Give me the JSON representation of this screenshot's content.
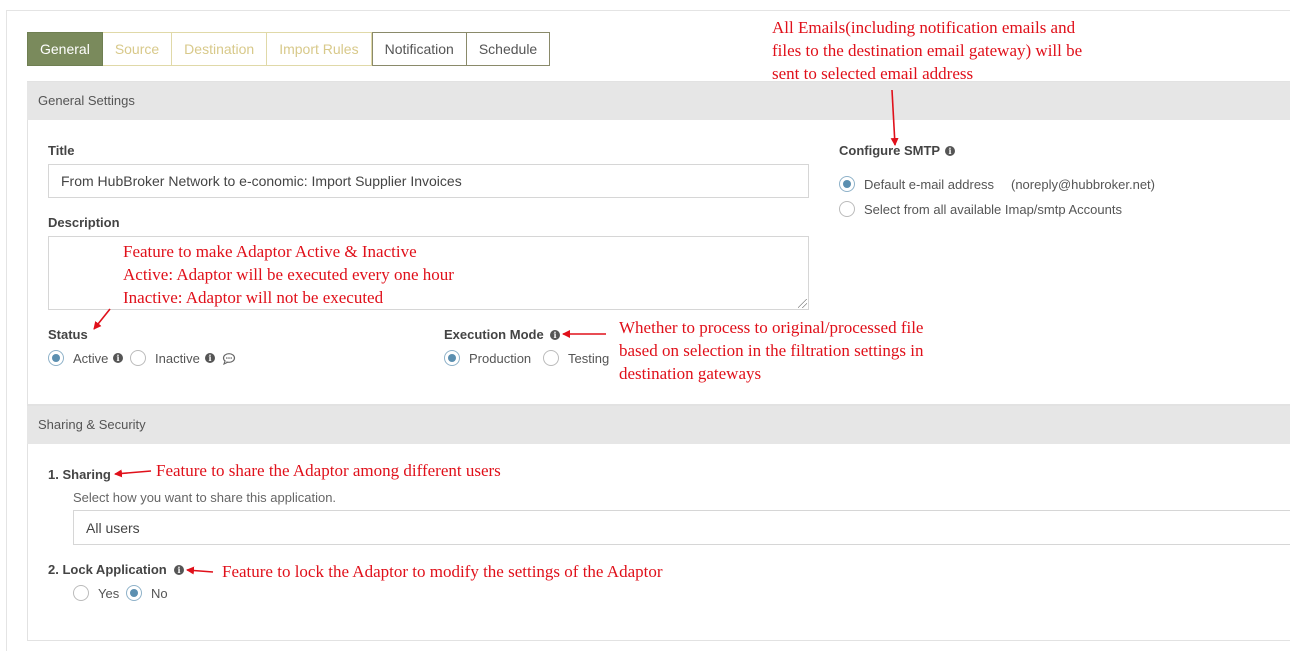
{
  "tabs": [
    {
      "label": "General",
      "state": "active"
    },
    {
      "label": "Source",
      "state": "disabled"
    },
    {
      "label": "Destination",
      "state": "disabled"
    },
    {
      "label": "Import Rules",
      "state": "disabled"
    },
    {
      "label": "Notification",
      "state": "normal"
    },
    {
      "label": "Schedule",
      "state": "normal"
    }
  ],
  "general": {
    "header": "General Settings",
    "title_label": "Title",
    "title_value": "From HubBroker Network to e-conomic: Import Supplier Invoices",
    "description_label": "Description",
    "status": {
      "label": "Status",
      "options": [
        "Active",
        "Inactive"
      ],
      "selected": "Active"
    },
    "execution_mode": {
      "label": "Execution Mode",
      "options": [
        "Production",
        "Testing"
      ],
      "selected": "Production"
    },
    "smtp": {
      "label": "Configure SMTP",
      "option_default": "Default e-mail address",
      "default_email": "(noreply@hubbroker.net)",
      "option_all": "Select from all available Imap/smtp Accounts"
    }
  },
  "sharing": {
    "header": "Sharing & Security",
    "sharing_label": "1. Sharing",
    "sharing_help": "Select how you want to share this application.",
    "sharing_value": "All users",
    "lock_label": "2. Lock Application",
    "lock_options": [
      "Yes",
      "No"
    ],
    "lock_selected": "No"
  },
  "annotations": {
    "smtp_note": [
      "All Emails(including notification emails and",
      "files to the destination email gateway) will be",
      "sent to selected email address"
    ],
    "status_note": [
      "Feature to make Adaptor Active & Inactive",
      "Active: Adaptor will be executed every one hour",
      "Inactive: Adaptor will not be executed"
    ],
    "exec_note": [
      "Whether to process to original/processed file",
      "based on selection in the filtration settings in",
      "destination gateways"
    ],
    "sharing_note": "Feature to share the Adaptor among different users",
    "lock_note": "Feature to lock the Adaptor to modify the settings of the Adaptor"
  },
  "colors": {
    "active_tab": "#7a8a5c",
    "annotation": "#e0101a",
    "radio_checked": "#5b8fb0"
  }
}
